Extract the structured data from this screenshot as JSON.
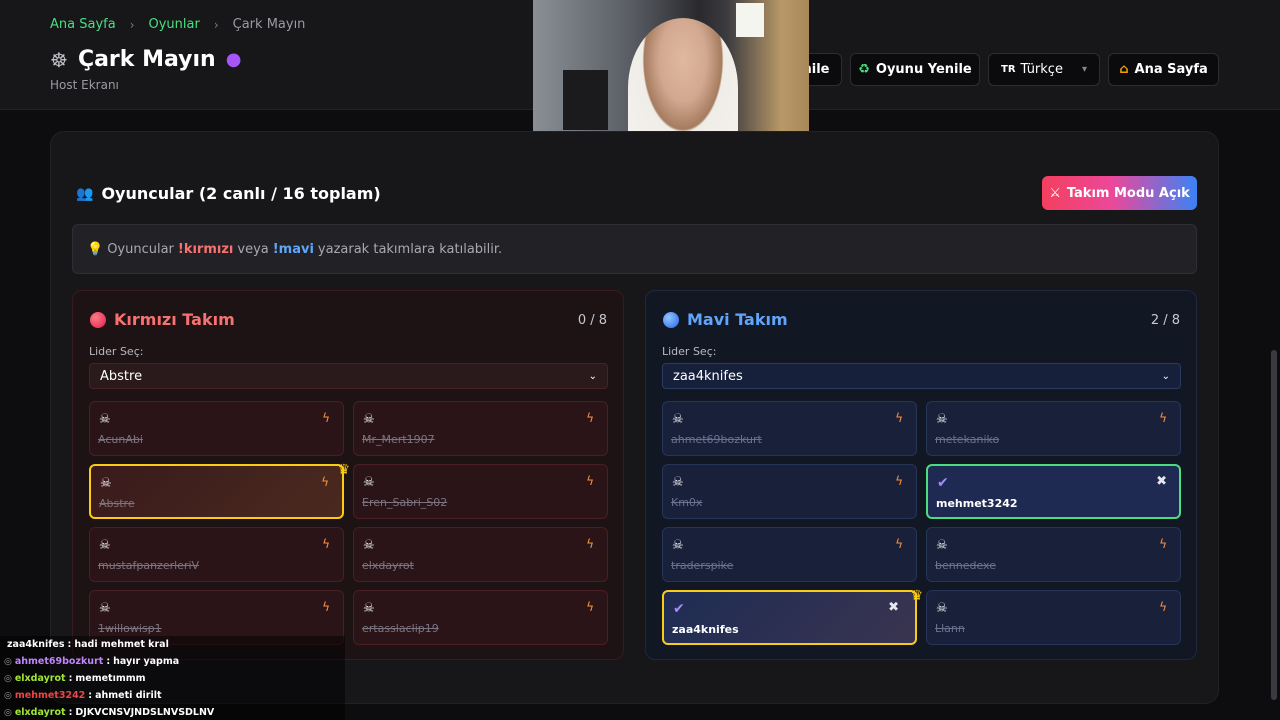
{
  "breadcrumb": {
    "home": "Ana Sayfa",
    "games": "Oyunlar",
    "current": "Çark Mayın"
  },
  "header": {
    "title": "Çark Mayın",
    "subtitle": "Host Ekranı",
    "partial_button": "nile",
    "refresh_button": "Oyunu Yenile",
    "language": {
      "flag": "TR",
      "selected": "Türkçe"
    },
    "home_button": "Ana Sayfa"
  },
  "players": {
    "title": "Oyuncular (2 canlı / 16 toplam)",
    "team_mode_button": "Takım Modu Açık",
    "info": {
      "prefix": "Oyuncular",
      "red_cmd": "!kırmızı",
      "or": "veya",
      "blue_cmd": "!mavi",
      "suffix": "yazarak takımlara katılabilir."
    }
  },
  "teams": {
    "red": {
      "name": "Kırmızı Takım",
      "count": "0 / 8",
      "leader_label": "Lider Seç:",
      "leader": "Abstre",
      "members": [
        "AcunAbi",
        "Mr_Mert1907",
        "Abstre",
        "Eren_Sabri_S02",
        "mustafpanzerleriV",
        "elxdayrot",
        "1willowisp1",
        "ertasslaclip19"
      ]
    },
    "blue": {
      "name": "Mavi Takım",
      "count": "2 / 8",
      "leader_label": "Lider Seç:",
      "leader": "zaa4knifes",
      "members": [
        "ahmet69bozkurt",
        "metekaniko",
        "Km0x",
        "mehmet3242",
        "traderspike",
        "bennedexe",
        "zaa4knifes",
        "Llann"
      ]
    }
  },
  "chat": [
    {
      "user": "zaa4knifes",
      "color": "#ffffff",
      "msg": "hadi mehmet kral",
      "badge": ""
    },
    {
      "user": "ahmet69bozkurt",
      "color": "#c084fc",
      "msg": "hayır yapma",
      "badge": "◎"
    },
    {
      "user": "elxdayrot",
      "color": "#a3e635",
      "msg": "memetımmm",
      "badge": "◎"
    },
    {
      "user": "mehmet3242",
      "color": "#ef4444",
      "msg": "ahmeti dirilt",
      "badge": "◎"
    },
    {
      "user": "elxdayrot",
      "color": "#a3e635",
      "msg": "DJKVCNSVJNDSLNVSDLNV",
      "badge": "◎"
    }
  ]
}
